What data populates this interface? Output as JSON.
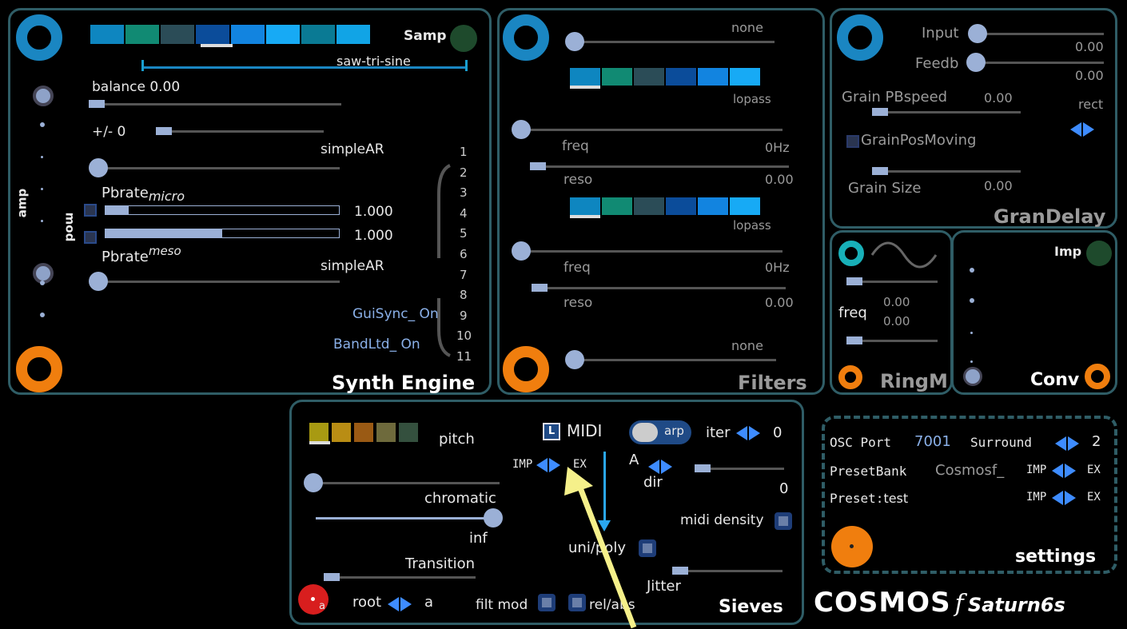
{
  "colors": {
    "accent_blue": "#1a86c2",
    "orange": "#f07e0e",
    "panel_border": "#2f5d66",
    "slider": "#9bb0d6",
    "arrow": "#3e8cff"
  },
  "synth": {
    "title": "Synth Engine",
    "samp_label": "Samp",
    "wave_label": "saw-tri-sine",
    "balance_label": "balance 0.00",
    "plusminus": "+/- 0",
    "env1": "simpleAR",
    "env2": "simpleAR",
    "pbrate_micro_base": "Pbrate",
    "pbrate_micro_sub": "micro",
    "pbrate_meso_base": "Pbrate",
    "pbrate_meso_sup": "meso",
    "val1": "1.000",
    "val2": "1.000",
    "bar1_fraction": 0.1,
    "bar2_fraction": 0.5,
    "amp_label": "amp",
    "mod_label": "mod",
    "numbers": [
      "1",
      "2",
      "3",
      "4",
      "5",
      "6",
      "7",
      "8",
      "9",
      "10",
      "11"
    ],
    "guisync": "GuiSync_ On",
    "bandltd": "BandLtd_ On",
    "swatches": [
      "#0e86c0",
      "#118a73",
      "#2b4c57",
      "#0b4c9a",
      "#1284e0",
      "#17aaf5",
      "#0a7a94",
      "#11a4e6"
    ]
  },
  "filters": {
    "title": "Filters",
    "none_top": "none",
    "none_bottom": "none",
    "lopass1": "lopass",
    "lopass2": "lopass",
    "freq1": "freq",
    "hz1": "0Hz",
    "reso1": "reso",
    "reso_val1": "0.00",
    "freq2": "freq",
    "hz2": "0Hz",
    "reso2": "reso",
    "reso_val2": "0.00",
    "swatches": [
      "#0e86c0",
      "#118a73",
      "#2b4c57",
      "#0b4c9a",
      "#1284e0",
      "#17aaf5"
    ]
  },
  "gran": {
    "title": "GranDelay",
    "input": "Input",
    "input_val": "0.00",
    "feedb": "Feedb",
    "feedb_val": "0.00",
    "pbspeed": "Grain PBspeed",
    "pbspeed_val": "0.00",
    "rect": "rect",
    "posmoving": "GrainPosMoving",
    "size": "Grain Size",
    "size_val": "0.00"
  },
  "ringm": {
    "title": "RingM",
    "freq": "freq",
    "v1": "0.00",
    "v2": "0.00"
  },
  "conv": {
    "title": "Conv",
    "imp": "Imp"
  },
  "sieves": {
    "title": "Sieves",
    "pitch": "pitch",
    "midi_box": "L",
    "midi": "MIDI",
    "arp": "arp",
    "iter": "iter",
    "iter_val": "0",
    "imp": "IMP",
    "ex": "EX",
    "a_label": "A",
    "dir": "dir",
    "dir_val": "0",
    "chromatic": "chromatic",
    "inf": "inf",
    "midi_density": "midi density",
    "unipoly": "uni/poly",
    "transition": "Transition",
    "jitter": "Jitter",
    "root": "root",
    "root_val": "a",
    "red_sub": "a",
    "filtmod": "filt mod",
    "relabs": "rel/abs",
    "swatches": [
      "#a89a12",
      "#b98d14",
      "#9a5a14",
      "#6e6a3c",
      "#34503e"
    ]
  },
  "settings": {
    "title": "settings",
    "osc_port": "OSC Port",
    "osc_val": "7001",
    "surround": "Surround",
    "surround_val": "2",
    "presetbank": "PresetBank",
    "presetbank_val": "Cosmosf_",
    "imp": "IMP",
    "ex": "EX",
    "preset": "Preset:",
    "preset_val": "test"
  },
  "brand": {
    "name": "COSMOS",
    "f": "f",
    "sub": "Saturn6s"
  }
}
